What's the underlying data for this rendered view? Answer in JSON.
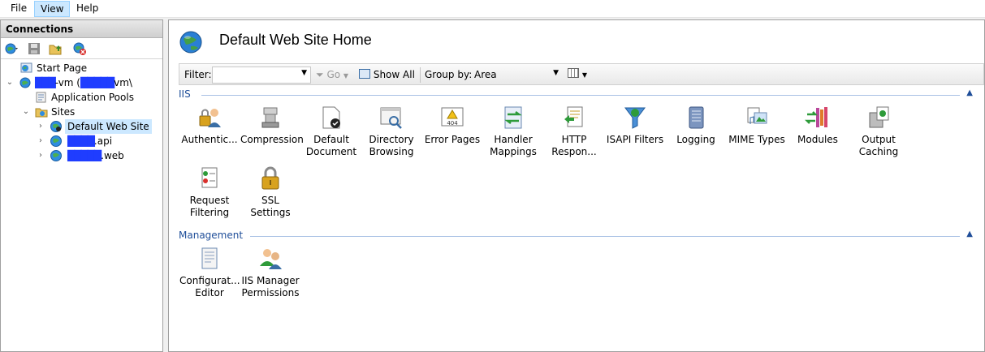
{
  "menu": {
    "items": [
      {
        "label": "File"
      },
      {
        "label": "View"
      },
      {
        "label": "Help"
      }
    ]
  },
  "connections": {
    "title": "Connections",
    "tree": [
      {
        "label": "Start Page"
      },
      {
        "label_prefix": "",
        "label_redacted": "███",
        "label_mid": "-vm (",
        "label_redacted2": "█████",
        "label_suffix": "vm\\"
      },
      {
        "label": "Application Pools"
      },
      {
        "label": "Sites"
      },
      {
        "label": "Default Web Site"
      },
      {
        "label_redacted": "████",
        "label_suffix": ".api"
      },
      {
        "label_redacted": "█████",
        "label_suffix": ".web"
      }
    ]
  },
  "main": {
    "title": "Default Web Site Home",
    "filter_bar": {
      "filter_label": "Filter:",
      "filter_value": "",
      "go_label": "Go",
      "show_all_label": "Show All",
      "group_by_label": "Group by:",
      "group_by_value": "Area"
    },
    "groups": [
      {
        "name": "IIS",
        "features": [
          {
            "label": "Authentic...",
            "icon": "authentication-icon"
          },
          {
            "label": "Compression",
            "icon": "compression-icon"
          },
          {
            "label": "Default Document",
            "icon": "default-document-icon"
          },
          {
            "label": "Directory Browsing",
            "icon": "directory-browsing-icon"
          },
          {
            "label": "Error Pages",
            "icon": "error-pages-icon"
          },
          {
            "label": "Handler Mappings",
            "icon": "handler-mappings-icon"
          },
          {
            "label": "HTTP Respon...",
            "icon": "http-response-icon"
          },
          {
            "label": "ISAPI Filters",
            "icon": "isapi-filters-icon"
          },
          {
            "label": "Logging",
            "icon": "logging-icon"
          },
          {
            "label": "MIME Types",
            "icon": "mime-types-icon"
          },
          {
            "label": "Modules",
            "icon": "modules-icon"
          },
          {
            "label": "Output Caching",
            "icon": "output-caching-icon"
          },
          {
            "label": "Request Filtering",
            "icon": "request-filtering-icon"
          },
          {
            "label": "SSL Settings",
            "icon": "ssl-settings-icon"
          }
        ]
      },
      {
        "name": "Management",
        "features": [
          {
            "label": "Configurat... Editor",
            "icon": "configuration-editor-icon"
          },
          {
            "label": "IIS Manager Permissions",
            "icon": "iis-manager-permissions-icon"
          }
        ]
      }
    ],
    "error_pages_badge": "404"
  },
  "colors": {
    "accent": "#1f4e99",
    "selection": "#cce8ff",
    "redaction": "#1f3dff"
  }
}
